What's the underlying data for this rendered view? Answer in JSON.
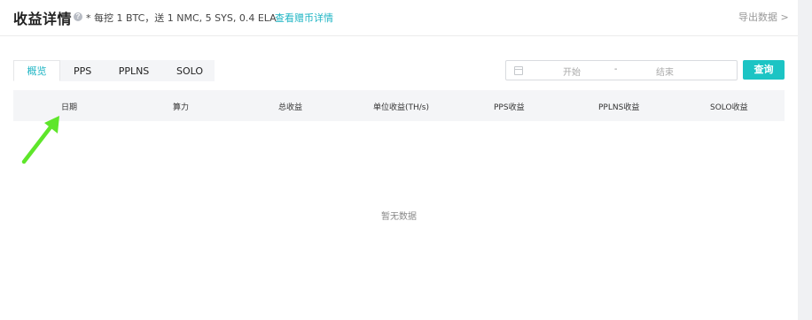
{
  "header": {
    "title": "收益详情",
    "note": "* 每挖 1 BTC，送 1 NMC, 5 SYS, 0.4 ELA",
    "note_link": "查看赠币详情",
    "export_label": "导出数据 >"
  },
  "tabs": [
    {
      "label": "概览",
      "active": true
    },
    {
      "label": "PPS",
      "active": false
    },
    {
      "label": "PPLNS",
      "active": false
    },
    {
      "label": "SOLO",
      "active": false
    }
  ],
  "filter": {
    "start_placeholder": "开始",
    "separator": "-",
    "end_placeholder": "结束",
    "query_label": "查询"
  },
  "table": {
    "columns": [
      "日期",
      "算力",
      "总收益",
      "单位收益(TH/s)",
      "PPS收益",
      "PPLNS收益",
      "SOLO收益"
    ],
    "empty_text": "暂无数据"
  },
  "colors": {
    "accent": "#1cc4c4",
    "link": "#1fb5c4",
    "annotation_arrow": "#5ee62a"
  }
}
